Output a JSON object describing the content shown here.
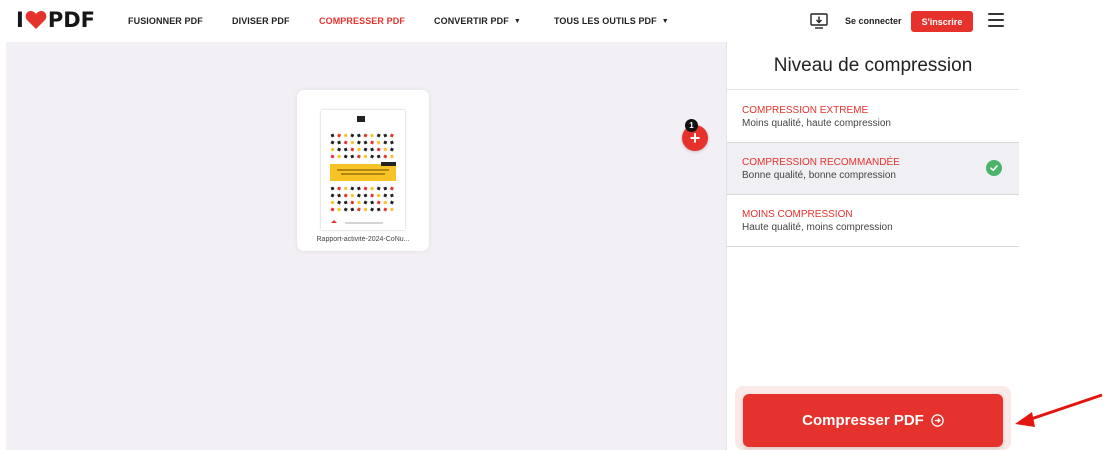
{
  "header": {
    "logo_left": "I",
    "logo_right": "PDF",
    "nav": [
      {
        "label": "FUSIONNER PDF"
      },
      {
        "label": "DIVISER PDF"
      },
      {
        "label": "COMPRESSER PDF"
      },
      {
        "label": "CONVERTIR PDF",
        "caret": "▼"
      },
      {
        "label": "TOUS LES OUTILS PDF",
        "caret": "▼"
      }
    ],
    "login": "Se connecter",
    "signup": "S'inscrire"
  },
  "workspace": {
    "file_count": "1",
    "add_symbol": "+",
    "file": {
      "name": "Rapport-activité-2024-CoNu..."
    }
  },
  "sidebar": {
    "title": "Niveau de compression",
    "options": [
      {
        "title": "COMPRESSION EXTREME",
        "desc": "Moins qualité, haute compression",
        "selected": false
      },
      {
        "title": "COMPRESSION RECOMMANDÉE",
        "desc": "Bonne qualité, bonne compression",
        "selected": true
      },
      {
        "title": "MOINS COMPRESSION",
        "desc": "Haute qualité, moins compression",
        "selected": false
      }
    ],
    "action": "Compresser PDF"
  },
  "colors": {
    "brand": "#e5322d",
    "selected_bg": "#f0eff3",
    "check": "#4bb36a",
    "workspace_bg": "#f3f0f5"
  },
  "icons": {
    "logo": "heart-icon",
    "desktop": "download-desktop-icon",
    "menu": "hamburger-menu-icon",
    "selected": "check-circle-icon",
    "action": "arrow-right-circle-icon"
  }
}
